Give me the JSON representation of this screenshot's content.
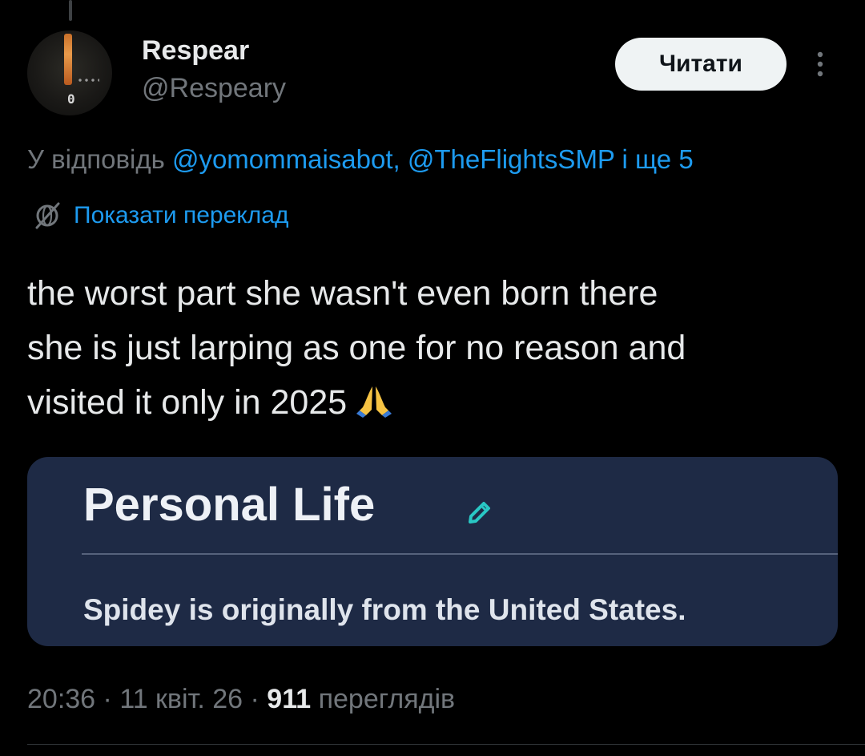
{
  "author": {
    "name": "Respear",
    "handle": "@Respeary",
    "avatar_text": "0"
  },
  "follow_button": {
    "label": "Читати"
  },
  "more_button": {
    "icon": "more-vertical-icon"
  },
  "reply_context": {
    "prefix": "У відповідь ",
    "mentions": "@yomommaisabot, @TheFlightsSMP",
    "suffix": " і ще 5"
  },
  "translate": {
    "label": "Показати переклад",
    "icon": "globe-icon"
  },
  "tweet": {
    "lines": [
      "the worst part she wasn't even born there",
      "she is just larping as one for no reason and",
      "visited it only in 2025"
    ],
    "emoji_icon": "praying-hands-icon"
  },
  "attached_image": {
    "title": "Personal Life",
    "edit_icon": "pencil-icon",
    "text": "Spidey is originally from the United States."
  },
  "meta": {
    "time": "20:36",
    "sep1": " · ",
    "date": "11 квіт. 26",
    "sep2": " · ",
    "views_count": "911",
    "views_label": " переглядів"
  },
  "colors": {
    "background": "#000000",
    "link": "#1d9bf0",
    "secondary_text": "#71767b",
    "card_background": "#1e2a45"
  }
}
